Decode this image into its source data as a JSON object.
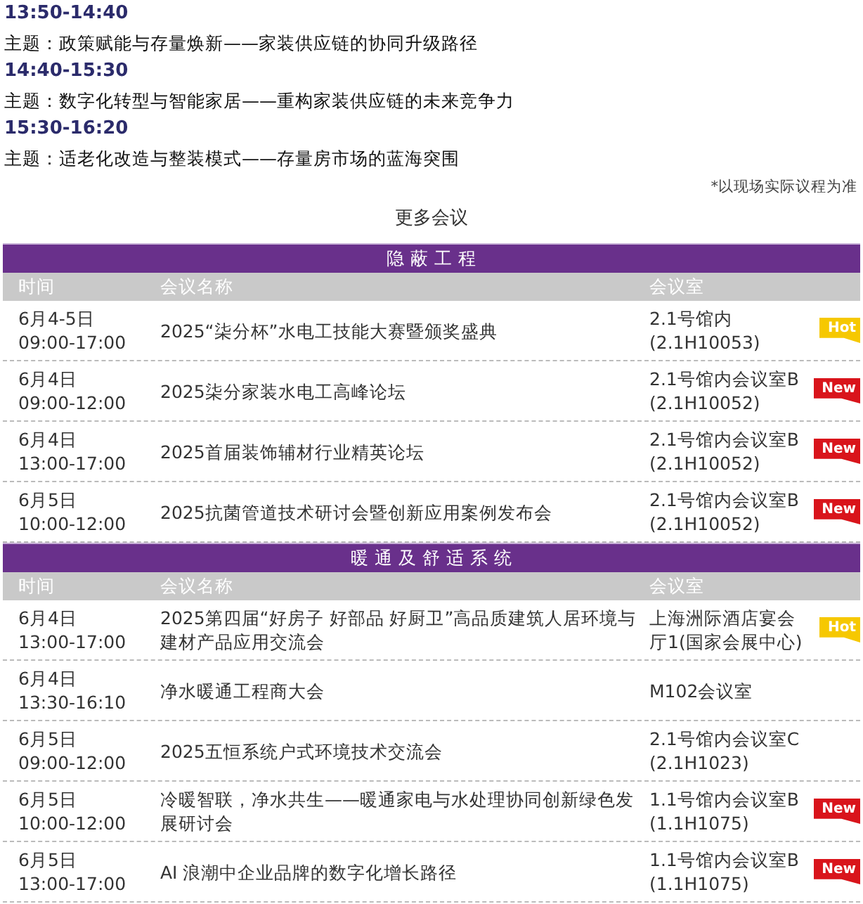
{
  "agenda": [
    {
      "time": "13:50-14:40",
      "topic": "主题：政策赋能与存量焕新——家装供应链的协同升级路径"
    },
    {
      "time": "14:40-15:30",
      "topic": "主题：数字化转型与智能家居——重构家装供应链的未来竞争力"
    },
    {
      "time": "15:30-16:20",
      "topic": "主题：适老化改造与整装模式——存量房市场的蓝海突围"
    }
  ],
  "note": "*以现场实际议程为准",
  "more_title": "更多会议",
  "sections": [
    {
      "title": "隐 蔽 工 程",
      "columns": [
        "时间",
        "会议名称",
        "会议室"
      ],
      "rows": [
        {
          "date": "6月4-5日",
          "time": "09:00-17:00",
          "name": "2025“柒分杯”水电工技能大赛暨颁奖盛典",
          "room": [
            "2.1号馆内",
            "(2.1H10053)"
          ],
          "badge": {
            "kind": "hot",
            "text": "Hot"
          }
        },
        {
          "date": "6月4日",
          "time": "09:00-12:00",
          "name": "2025柒分家装水电工高峰论坛",
          "room": [
            "2.1号馆内会议室B",
            "(2.1H10052)"
          ],
          "badge": {
            "kind": "new",
            "text": "New"
          }
        },
        {
          "date": "6月4日",
          "time": "13:00-17:00",
          "name": "2025首届装饰辅材行业精英论坛",
          "room": [
            "2.1号馆内会议室B",
            "(2.1H10052)"
          ],
          "badge": {
            "kind": "new",
            "text": "New"
          }
        },
        {
          "date": "6月5日",
          "time": "10:00-12:00",
          "name": "2025抗菌管道技术研讨会暨创新应用案例发布会",
          "room": [
            "2.1号馆内会议室B",
            "(2.1H10052)"
          ],
          "badge": {
            "kind": "new",
            "text": "New"
          }
        }
      ]
    },
    {
      "title": "暖 通 及 舒 适 系 统",
      "columns": [
        "时间",
        "会议名称",
        "会议室"
      ],
      "rows": [
        {
          "date": "6月4日",
          "time": "13:00-17:00",
          "name": "2025第四届“好房子 好部品 好厨卫”高品质建筑人居环境与建材产品应用交流会",
          "room": [
            "上海洲际酒店宴会厅1(国家会展中心)"
          ],
          "badge": {
            "kind": "hot",
            "text": "Hot"
          }
        },
        {
          "date": "6月4日",
          "time": "13:30-16:10",
          "name": "净水暖通工程商大会",
          "room": [
            "M102会议室"
          ]
        },
        {
          "date": "6月5日",
          "time": "09:00-12:00",
          "name": "2025五恒系统户式环境技术交流会",
          "room": [
            "2.1号馆内会议室C",
            "(2.1H1023)"
          ]
        },
        {
          "date": "6月5日",
          "time": "10:00-12:00",
          "name": "冷暖智联，净水共生——暖通家电与水处理协同创新绿色发展研讨会",
          "room": [
            "1.1号馆内会议室B",
            "(1.1H1075)"
          ],
          "badge": {
            "kind": "new",
            "text": "New"
          }
        },
        {
          "date": "6月5日",
          "time": "13:00-17:00",
          "name": "AI 浪潮中企业品牌的数字化增长路径",
          "room": [
            "1.1号馆内会议室B",
            "(1.1H1075)"
          ],
          "badge": {
            "kind": "new",
            "text": "New"
          }
        }
      ]
    }
  ]
}
